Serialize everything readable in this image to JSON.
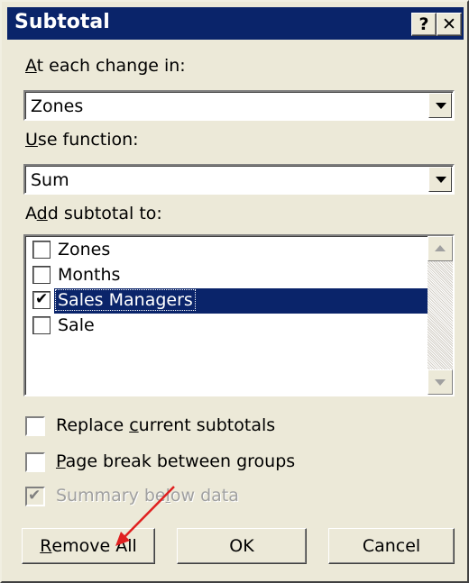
{
  "window": {
    "title": "Subtotal"
  },
  "titlebar": {
    "help_label": "?",
    "close_label": "✕"
  },
  "at_each_change": {
    "label_prefix": "A",
    "label_rest": "t each change in:",
    "value": "Zones"
  },
  "use_function": {
    "label_prefix": "U",
    "label_rest": "se function:",
    "value": "Sum"
  },
  "add_subtotal": {
    "label_pre": "A",
    "label_u": "d",
    "label_rest": "d subtotal to:",
    "items": [
      {
        "label": "Zones",
        "checked": false
      },
      {
        "label": "Months",
        "checked": false
      },
      {
        "label": "Sales Managers",
        "checked": true,
        "selected": true
      },
      {
        "label": "Sale",
        "checked": false
      }
    ]
  },
  "options": {
    "replace": {
      "pre": "Replace ",
      "u": "c",
      "rest": "urrent subtotals",
      "checked": false
    },
    "pagebreak": {
      "pre": "",
      "u": "P",
      "rest": "age break between groups",
      "checked": false
    },
    "summary": {
      "pre": "Summary be",
      "u": "l",
      "rest": "ow data",
      "checked": true,
      "disabled": true
    }
  },
  "buttons": {
    "remove_u": "R",
    "remove_rest": "emove All",
    "ok": "OK",
    "cancel": "Cancel"
  },
  "colors": {
    "titlebar": "#0a246a",
    "selection": "#0a246a",
    "dialog_bg": "#ece9d8",
    "annotation_arrow": "#e02020"
  },
  "check_glyph": "✔"
}
